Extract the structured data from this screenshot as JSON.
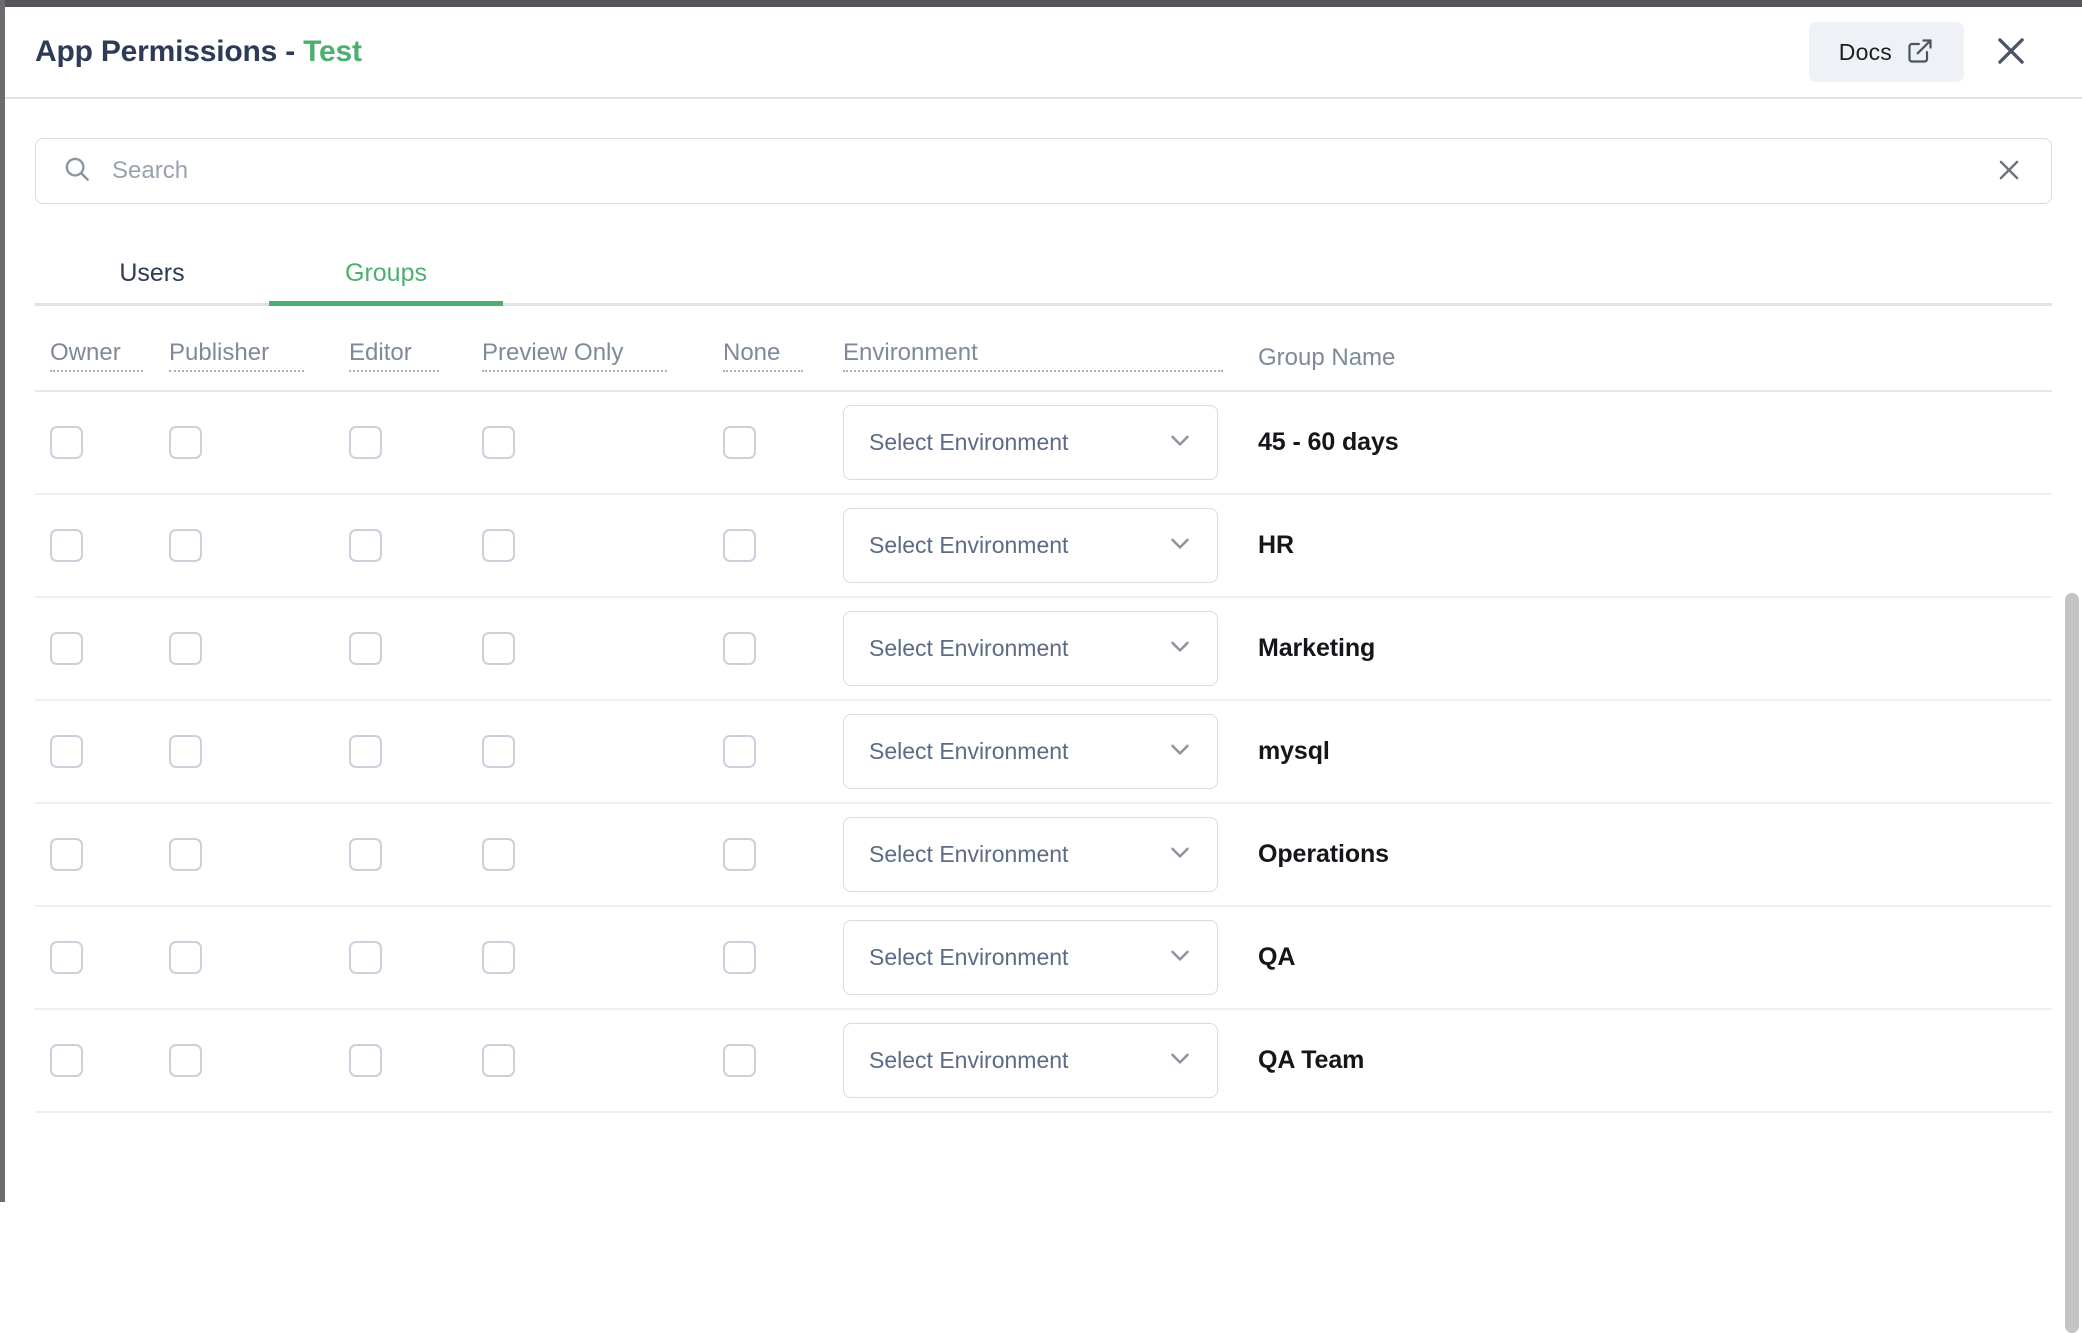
{
  "window": {
    "title_prefix": "App Permissions - ",
    "title_accent": "Test"
  },
  "header": {
    "docs_label": "Docs",
    "docs_icon": "external-link-icon",
    "close_icon": "close-icon"
  },
  "search": {
    "placeholder": "Search",
    "value": "",
    "icon": "search-icon",
    "clear_icon": "close-icon"
  },
  "tabs": [
    {
      "label": "Users",
      "active": false
    },
    {
      "label": "Groups",
      "active": true
    }
  ],
  "table": {
    "columns": [
      {
        "key": "owner",
        "label": "Owner",
        "dotted": true
      },
      {
        "key": "publisher",
        "label": "Publisher",
        "dotted": true
      },
      {
        "key": "editor",
        "label": "Editor",
        "dotted": true
      },
      {
        "key": "preview",
        "label": "Preview Only",
        "dotted": true
      },
      {
        "key": "none",
        "label": "None",
        "dotted": true
      },
      {
        "key": "env",
        "label": "Environment",
        "dotted": true
      },
      {
        "key": "name",
        "label": "Group Name",
        "dotted": false
      }
    ],
    "env_placeholder": "Select Environment",
    "env_chevron_icon": "chevron-down-icon",
    "rows": [
      {
        "name": "45 - 60 days",
        "owner": false,
        "publisher": false,
        "editor": false,
        "preview": false,
        "none": false,
        "environment": ""
      },
      {
        "name": "HR",
        "owner": false,
        "publisher": false,
        "editor": false,
        "preview": false,
        "none": false,
        "environment": ""
      },
      {
        "name": "Marketing",
        "owner": false,
        "publisher": false,
        "editor": false,
        "preview": false,
        "none": false,
        "environment": ""
      },
      {
        "name": "mysql",
        "owner": false,
        "publisher": false,
        "editor": false,
        "preview": false,
        "none": false,
        "environment": ""
      },
      {
        "name": "Operations",
        "owner": false,
        "publisher": false,
        "editor": false,
        "preview": false,
        "none": false,
        "environment": ""
      },
      {
        "name": "QA",
        "owner": false,
        "publisher": false,
        "editor": false,
        "preview": false,
        "none": false,
        "environment": ""
      },
      {
        "name": "QA Team",
        "owner": false,
        "publisher": false,
        "editor": false,
        "preview": false,
        "none": false,
        "environment": ""
      }
    ]
  },
  "colors": {
    "accent_green": "#4caf70",
    "title_navy": "#2d3b57",
    "header_gray": "#7e8a99",
    "border": "#dfe3e6",
    "docs_bg": "#eef1f6"
  }
}
